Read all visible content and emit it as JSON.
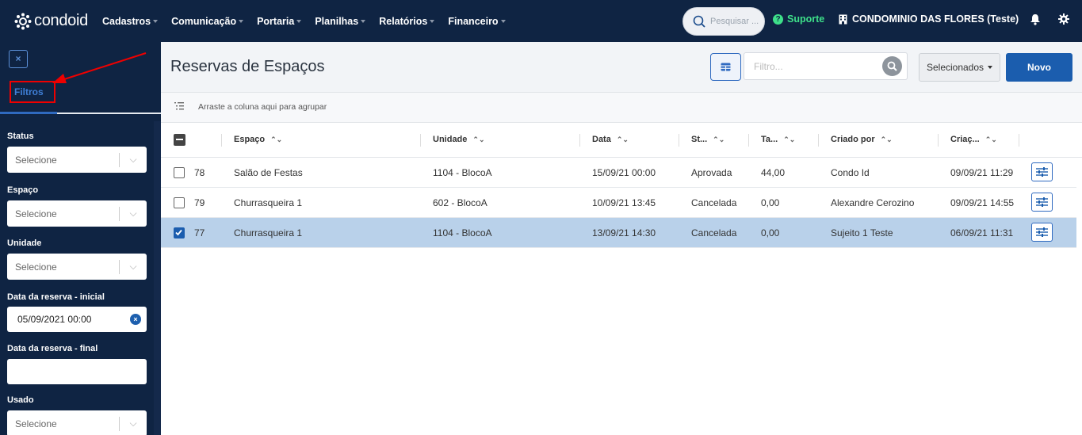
{
  "nav": {
    "brand": "condoid",
    "menu": [
      {
        "label": "Cadastros"
      },
      {
        "label": "Comunicação"
      },
      {
        "label": "Portaria"
      },
      {
        "label": "Planilhas"
      },
      {
        "label": "Relatórios"
      },
      {
        "label": "Financeiro"
      }
    ],
    "search_placeholder": "Pesquisar ...",
    "support_label": "Suporte",
    "condo_name": "CONDOMINIO DAS FLORES (Teste)",
    "colors": {
      "bg": "#0f2443",
      "support": "#3ee08a"
    }
  },
  "sidebar": {
    "close_icon": "×",
    "tab_label": "Filtros",
    "filters": [
      {
        "label": "Status",
        "value": "Selecione",
        "type": "select"
      },
      {
        "label": "Espaço",
        "value": "Selecione",
        "type": "select"
      },
      {
        "label": "Unidade",
        "value": "Selecione",
        "type": "select"
      },
      {
        "label": "Data da reserva - inicial",
        "value": "05/09/2021 00:00",
        "type": "date"
      },
      {
        "label": "Data da reserva - final",
        "value": "",
        "type": "date-empty"
      },
      {
        "label": "Usado",
        "value": "Selecione",
        "type": "select"
      }
    ]
  },
  "main": {
    "title": "Reservas de Espaços",
    "filter_placeholder": "Filtro...",
    "selected_label": "Selecionados",
    "new_label": "Novo",
    "group_hint": "Arraste a coluna aqui para agrupar",
    "columns": [
      "Espaço",
      "Unidade",
      "Data",
      "St...",
      "Ta...",
      "Criado por",
      "Criaç..."
    ],
    "rows": [
      {
        "id": "78",
        "espaco": "Salão de Festas",
        "unidade": "1104 - BlocoA",
        "data": "15/09/21 00:00",
        "status": "Aprovada",
        "taxa": "44,00",
        "criado_por": "Condo Id",
        "criacao": "09/09/21 11:29",
        "selected": false
      },
      {
        "id": "79",
        "espaco": "Churrasqueira 1",
        "unidade": "602 - BlocoA",
        "data": "10/09/21 13:45",
        "status": "Cancelada",
        "taxa": "0,00",
        "criado_por": "Alexandre Cerozino",
        "criacao": "09/09/21 14:55",
        "selected": false
      },
      {
        "id": "77",
        "espaco": "Churrasqueira 1",
        "unidade": "1104 - BlocoA",
        "data": "13/09/21 14:30",
        "status": "Cancelada",
        "taxa": "0,00",
        "criado_por": "Sujeito 1 Teste",
        "criacao": "06/09/21 11:31",
        "selected": true
      }
    ],
    "colors": {
      "primary": "#1b5dae",
      "selected_row": "#b9d1ea"
    }
  }
}
